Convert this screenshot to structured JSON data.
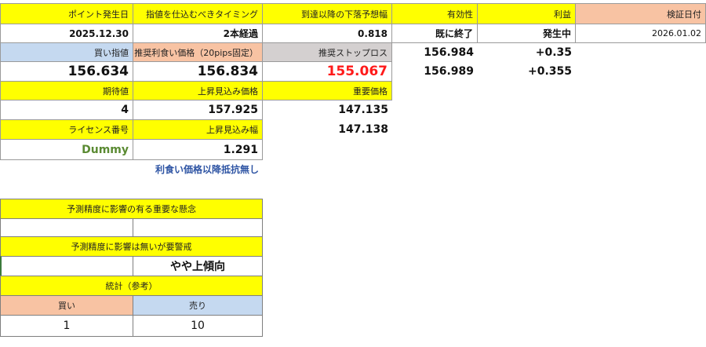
{
  "headers": {
    "point_date": "ポイント発生日",
    "timing": "指値を仕込むべきタイミング",
    "drop_forecast": "到達以降の下落予想幅",
    "validity": "有効性",
    "profit": "利益",
    "verify_date": "検証日付"
  },
  "values": {
    "point_date": "2025.12.30",
    "timing": "2本経過",
    "drop_forecast": "0.818",
    "validity": "既に終了",
    "profit": "発生中",
    "verify_date": "2026.01.02"
  },
  "row3": {
    "buy_limit_label": "買い指値",
    "take_profit_label": "推奨利食い価格（20pips固定）",
    "stop_loss_label": "推奨ストップロス",
    "side_price_1": "156.984",
    "side_profit_1": "+0.35"
  },
  "row4": {
    "buy_limit": "156.634",
    "take_profit": "156.834",
    "stop_loss": "155.067",
    "side_price_2": "156.989",
    "side_profit_2": "+0.355"
  },
  "row5": {
    "expected_label": "期待値",
    "rise_price_label": "上昇見込み価格",
    "key_price_label": "重要価格"
  },
  "row6": {
    "expected": "4",
    "rise_price": "157.925",
    "key_price_1": "147.135"
  },
  "row7": {
    "license_label": "ライセンス番号",
    "rise_width_label": "上昇見込み幅",
    "key_price_2": "147.138"
  },
  "row8": {
    "license": "Dummy",
    "rise_width": "1.291"
  },
  "note": "利食い価格以降抵抗無し",
  "concerns": {
    "title": "予測精度に影響の有る重要な懸念",
    "left": "",
    "right": ""
  },
  "warnings": {
    "title": "予測精度に影響は無いが要警戒",
    "left": "",
    "right": "やや上傾向"
  },
  "stats": {
    "title": "統計（参考）",
    "buy_label": "買い",
    "sell_label": "売り",
    "buy": "1",
    "sell": "10"
  },
  "colors": {
    "header_yellow": "#ffff00",
    "buy_blue": "#c5d9f0",
    "salmon": "#f8c3a3",
    "gray": "#d4d0d0",
    "stop_loss_red": "#ff1a1a",
    "license_green": "#5a8a32",
    "note_blue": "#2f55a4"
  }
}
